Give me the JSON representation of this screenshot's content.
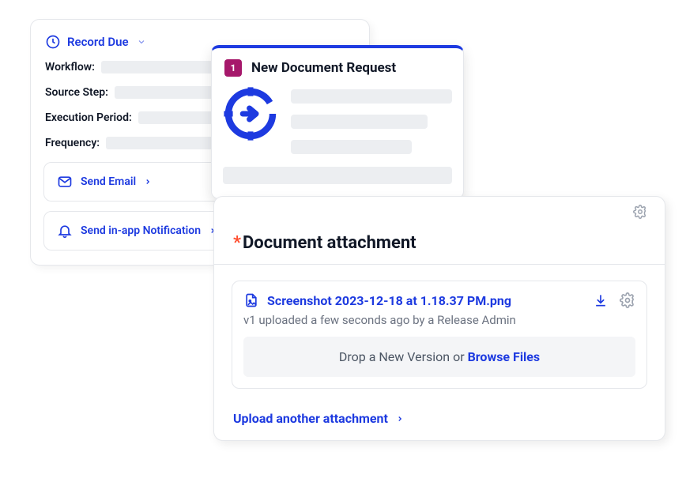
{
  "backCard": {
    "title": "Record Due",
    "fields": {
      "workflow": "Workflow:",
      "sourceStep": "Source Step:",
      "executionPeriod": "Execution Period:",
      "frequency": "Frequency:"
    },
    "actions": {
      "sendEmail": "Send Email",
      "sendNotification": "Send in-app Notification"
    }
  },
  "frontCard": {
    "badge": "1",
    "title": "New Document Request"
  },
  "attachment": {
    "heading": "Document attachment",
    "fileName": "Screenshot 2023-12-18 at 1.18.37 PM.png",
    "meta": "v1 uploaded a few seconds ago by a Release Admin",
    "dropPrefix": "Drop a New Version or ",
    "browse": "Browse Files",
    "uploadAnother": "Upload another attachment"
  }
}
